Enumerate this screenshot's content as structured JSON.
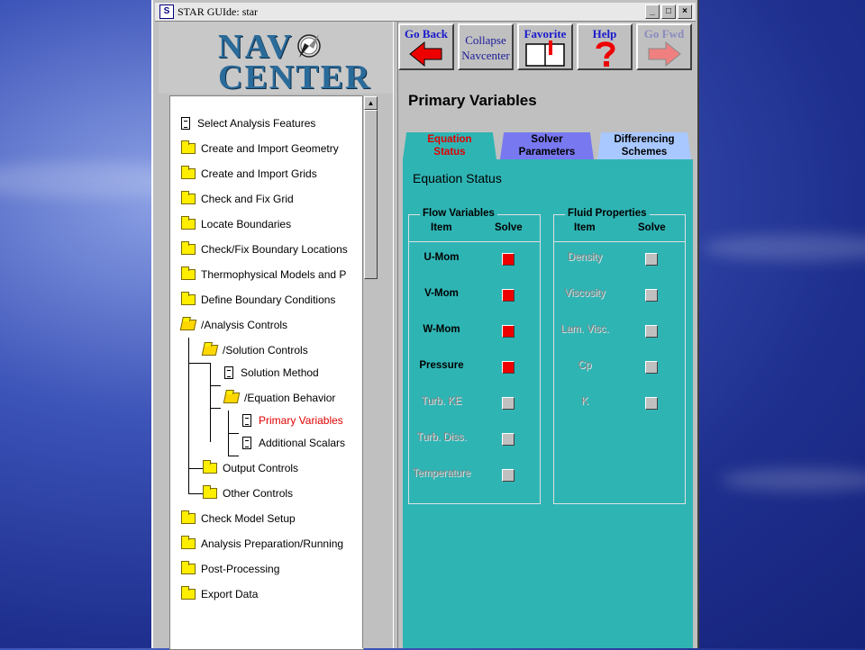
{
  "window": {
    "title": "STAR GUIde: star",
    "icon": "app-icon"
  },
  "logo": {
    "line1": "NAV",
    "line2": "CENTER"
  },
  "toolbar": {
    "go_back": "Go Back",
    "collapse_line1": "Collapse",
    "collapse_line2": "Navcenter",
    "favorite": "Favorite",
    "help": "Help",
    "go_fwd": "Go Fwd"
  },
  "tree": {
    "items": [
      {
        "label": "Select Analysis Features",
        "icon": "document-icon"
      },
      {
        "label": "Create and Import Geometry",
        "icon": "folder-icon"
      },
      {
        "label": "Create and Import Grids",
        "icon": "folder-icon"
      },
      {
        "label": "Check and Fix Grid",
        "icon": "folder-icon"
      },
      {
        "label": "Locate Boundaries",
        "icon": "folder-icon"
      },
      {
        "label": "Check/Fix Boundary Locations",
        "icon": "folder-icon"
      },
      {
        "label": "Thermophysical Models and P",
        "icon": "folder-icon"
      },
      {
        "label": "Define Boundary Conditions",
        "icon": "folder-icon"
      },
      {
        "label": "/Analysis Controls",
        "icon": "open-folder-icon"
      },
      {
        "label": "/Solution Controls",
        "icon": "open-folder-icon"
      },
      {
        "label": "Solution Method",
        "icon": "document-icon"
      },
      {
        "label": "/Equation Behavior",
        "icon": "open-folder-icon"
      },
      {
        "label": "Primary Variables",
        "icon": "document-icon",
        "selected": true
      },
      {
        "label": "Additional Scalars",
        "icon": "document-icon"
      },
      {
        "label": "Output Controls",
        "icon": "folder-icon"
      },
      {
        "label": "Other Controls",
        "icon": "folder-icon"
      },
      {
        "label": "Check Model Setup",
        "icon": "folder-icon"
      },
      {
        "label": "Analysis Preparation/Running",
        "icon": "folder-icon"
      },
      {
        "label": "Post-Processing",
        "icon": "folder-icon"
      },
      {
        "label": "Export Data",
        "icon": "folder-icon"
      }
    ]
  },
  "page": {
    "title": "Primary Variables"
  },
  "tabs": [
    {
      "line1": "Equation",
      "line2": "Status",
      "active": true
    },
    {
      "line1": "Solver",
      "line2": "Parameters"
    },
    {
      "line1": "Differencing",
      "line2": "Schemes"
    }
  ],
  "panel": {
    "title": "Equation Status",
    "flow": {
      "title": "Flow Variables",
      "col_item": "Item",
      "col_solve": "Solve",
      "rows": [
        {
          "label": "U-Mom",
          "checked": true,
          "enabled": true
        },
        {
          "label": "V-Mom",
          "checked": true,
          "enabled": true
        },
        {
          "label": "W-Mom",
          "checked": true,
          "enabled": true
        },
        {
          "label": "Pressure",
          "checked": true,
          "enabled": true
        },
        {
          "label": "Turb. KE",
          "checked": false,
          "enabled": false
        },
        {
          "label": "Turb. Diss.",
          "checked": false,
          "enabled": false
        },
        {
          "label": "Temperature",
          "checked": false,
          "enabled": false
        }
      ]
    },
    "fluid": {
      "title": "Fluid Properties",
      "col_item": "Item",
      "col_solve": "Solve",
      "rows": [
        {
          "label": "Density",
          "checked": false,
          "enabled": false
        },
        {
          "label": "Viscosity",
          "checked": false,
          "enabled": false
        },
        {
          "label": "Lam. Visc.",
          "checked": false,
          "enabled": false
        },
        {
          "label": "Cp",
          "checked": false,
          "enabled": false
        },
        {
          "label": "K",
          "checked": false,
          "enabled": false
        }
      ]
    }
  },
  "colors": {
    "panel": "#2fb4b4",
    "active_tab_text": "#e00000",
    "checked": "#ee0000",
    "selected_tree": "#e00000"
  }
}
